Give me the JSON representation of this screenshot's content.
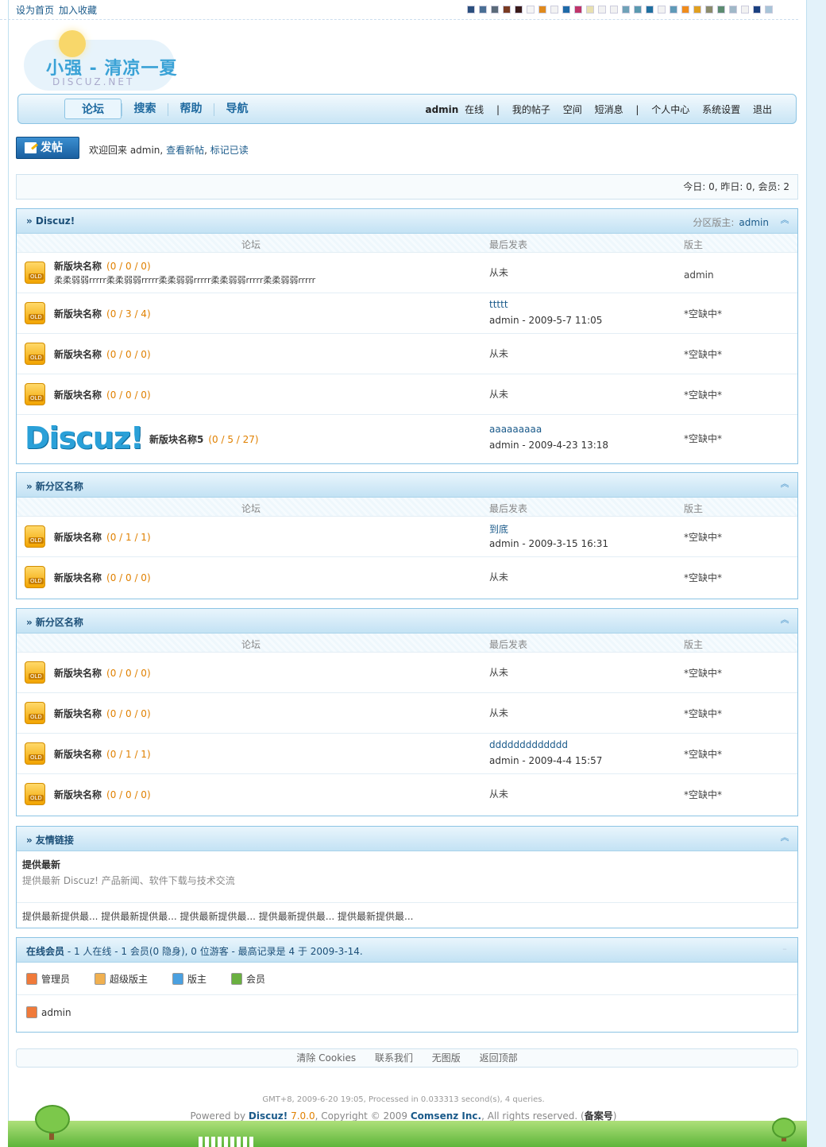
{
  "topbar": {
    "set_home": "设为首页",
    "add_fav": "加入收藏",
    "swatches": [
      "#2b4f7e",
      "#4a6f95",
      "#5b6b7a",
      "#7a3b22",
      "#3a1a1a",
      "#f5f5f5",
      "#e08a1c",
      "#f3f3f3",
      "#1e6aa8",
      "#c0356a",
      "#e8e0b0",
      "#f2f2f2",
      "#f2f2f2",
      "#6fa2b8",
      "#5a9ab0",
      "#1f70a0",
      "#f2f2f2",
      "#5f9ab8",
      "#f08c1c",
      "#e0a020",
      "#8c8c6c",
      "#5c8c70",
      "#a0b8c8",
      "#f2f2f2",
      "#1a4080",
      "#a8c4d8"
    ]
  },
  "logo": {
    "title": "小强 - 清凉一夏",
    "sub": "DISCUZ.NET"
  },
  "nav": {
    "tabs": [
      "论坛",
      "搜索",
      "帮助",
      "导航"
    ],
    "user": "admin",
    "status": "在线",
    "sep": "|",
    "links": [
      "我的帖子",
      "空间",
      "短消息"
    ],
    "links2": [
      "个人中心",
      "系统设置",
      "退出"
    ]
  },
  "post_button": "发帖",
  "welcome": {
    "text": "欢迎回来 admin,",
    "new_posts": "查看新帖",
    "mark_read": "标记已读"
  },
  "stats": "今日: 0, 昨日: 0, 会员: 2",
  "cols": {
    "forum": "论坛",
    "last": "最后发表",
    "mod": "版主"
  },
  "sections": [
    {
      "title": "» Discuz!",
      "mod_label": "分区版主:",
      "mod": "admin",
      "rows": [
        {
          "name": "新版块名称",
          "counts": "(0 / 0 / 0)",
          "desc": "柔柔弱弱rrrrr柔柔弱弱rrrrr柔柔弱弱rrrrr柔柔弱弱rrrrr柔柔弱弱rrrrr",
          "last": "从未",
          "mod": "admin"
        },
        {
          "name": "新版块名称",
          "counts": "(0 / 3 / 4)",
          "last_title": "ttttt",
          "last_by": "admin - 2009-5-7 11:05",
          "mod": "*空缺中*"
        },
        {
          "name": "新版块名称",
          "counts": "(0 / 0 / 0)",
          "last": "从未",
          "mod": "*空缺中*"
        },
        {
          "name": "新版块名称",
          "counts": "(0 / 0 / 0)",
          "last": "从未",
          "mod": "*空缺中*"
        },
        {
          "name": "新版块名称5",
          "counts": "(0 / 5 / 27)",
          "logo": "Discuz!",
          "last_title": "aaaaaaaaa",
          "last_by": "admin - 2009-4-23 13:18",
          "mod": "*空缺中*"
        }
      ]
    },
    {
      "title": "» 新分区名称",
      "rows": [
        {
          "name": "新版块名称",
          "counts": "(0 / 1 / 1)",
          "last_title": "到底",
          "last_by": "admin - 2009-3-15 16:31",
          "mod": "*空缺中*"
        },
        {
          "name": "新版块名称",
          "counts": "(0 / 0 / 0)",
          "last": "从未",
          "mod": "*空缺中*"
        }
      ]
    },
    {
      "title": "» 新分区名称",
      "rows": [
        {
          "name": "新版块名称",
          "counts": "(0 / 0 / 0)",
          "last": "从未",
          "mod": "*空缺中*"
        },
        {
          "name": "新版块名称",
          "counts": "(0 / 0 / 0)",
          "last": "从未",
          "mod": "*空缺中*"
        },
        {
          "name": "新版块名称",
          "counts": "(0 / 1 / 1)",
          "last_title": "ddddddddddddd",
          "last_by": "admin - 2009-4-4 15:57",
          "mod": "*空缺中*"
        },
        {
          "name": "新版块名称",
          "counts": "(0 / 0 / 0)",
          "last": "从未",
          "mod": "*空缺中*"
        }
      ]
    }
  ],
  "links_box": {
    "title": "» 友情链接",
    "item_title": "提供最新",
    "item_desc": "提供最新 Discuz! 产品新闻、软件下载与技术交流",
    "more": "提供最新提供最... 提供最新提供最... 提供最新提供最... 提供最新提供最... 提供最新提供最..."
  },
  "online": {
    "label": "在线会员",
    "summary": " - 1 人在线 - 1 会员(0 隐身), 0 位游客 - 最高记录是 4 于 2009-3-14.",
    "legend": [
      {
        "label": "管理员",
        "color": "#f07a3a"
      },
      {
        "label": "超级版主",
        "color": "#f0b050"
      },
      {
        "label": "版主",
        "color": "#4aa0e0"
      },
      {
        "label": "会员",
        "color": "#6ab040"
      }
    ],
    "user": "admin"
  },
  "footer": {
    "links": [
      "清除 Cookies",
      "联系我们",
      "无图版",
      "返回顶部"
    ],
    "proc": "GMT+8, 2009-6-20 19:05, Processed in 0.033313 second(s), 4 queries.",
    "powered_pre": "Powered by ",
    "powered_name": "Discuz!",
    "powered_ver": " 7.0.0",
    "copy_pre": ", Copyright © 2009 ",
    "copy_name": "Comsenz Inc.",
    "copy_post": ", All rights reserved. (",
    "icp": "备案号",
    "close": ")"
  }
}
